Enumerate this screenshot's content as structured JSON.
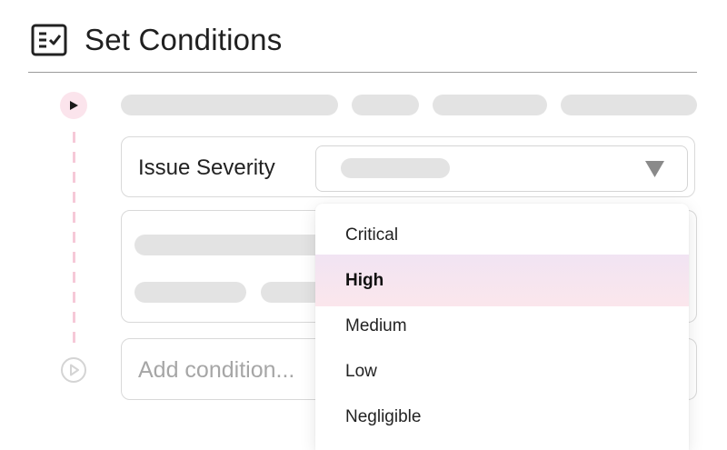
{
  "header": {
    "icon": "checklist-icon",
    "title": "Set Conditions"
  },
  "condition": {
    "label": "Issue Severity",
    "selected_value": "",
    "arrow_icon": "triangle-down-icon"
  },
  "add_condition": {
    "placeholder": "Add condition..."
  },
  "dropdown": {
    "options": [
      {
        "label": "Critical",
        "selected": false
      },
      {
        "label": "High",
        "selected": true
      },
      {
        "label": "Medium",
        "selected": false
      },
      {
        "label": "Low",
        "selected": false
      },
      {
        "label": "Negligible",
        "selected": false
      }
    ]
  },
  "colors": {
    "accent_pink": "#fbe4ec",
    "timeline_dash": "#f6c9d8",
    "skeleton": "#e3e3e3"
  }
}
